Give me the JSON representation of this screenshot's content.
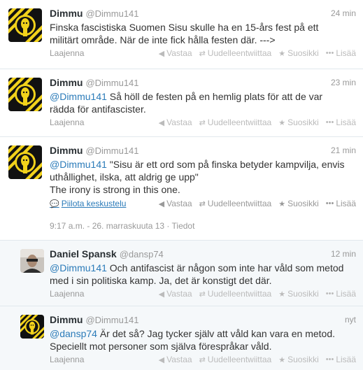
{
  "tweets": [
    {
      "name": "Dimmu",
      "handle": "@Dimmu141",
      "time": "24 min",
      "line1": "Finska fascistiska Suomen Sisu skulle ha en 15-års fest på ett",
      "line2": "militärt område. När de inte fick hålla festen där. --->",
      "expand": "Laajenna"
    },
    {
      "name": "Dimmu",
      "handle": "@Dimmu141",
      "time": "23 min",
      "mention": "@Dimmu141",
      "line1_rest": "  Så höll de festen på en hemlig plats för att de var",
      "line2": "rädda för antifascister.",
      "expand": "Laajenna"
    },
    {
      "name": "Dimmu",
      "handle": "@Dimmu141",
      "time": "21 min",
      "mention": "@Dimmu141",
      "line1_rest": " \"Sisu är ett ord som på finska betyder kampvilja, envis",
      "line2": "uthållighet, ilska, att aldrig ge upp\"",
      "line3": "The irony is strong in this one.",
      "hide_thread": "Piilota keskustelu",
      "meta": "9:17 a.m. - 26. marraskuuta 13 · Tiedot"
    },
    {
      "name": "Daniel Spansk",
      "handle": "@dansp74",
      "time": "12 min",
      "mention": "@Dimmu141",
      "line1_rest": " Och antifascist är någon som inte har våld som metod",
      "line2": "med i sin politiska kamp.  Ja, det är konstigt det där.",
      "expand": "Laajenna"
    },
    {
      "name": "Dimmu",
      "handle": "@Dimmu141",
      "time": "nyt",
      "mention": "@dansp74",
      "line1_rest": " Är det så? Jag tycker själv att våld kan vara en metod.",
      "line2": "Speciellt mot personer som själva förespråkar våld.",
      "expand": "Laajenna"
    }
  ],
  "actions": {
    "reply": "Vastaa",
    "retweet": "Uudelleentwiittaa",
    "favorite": "Suosikki",
    "more": "Lisää"
  },
  "icons": {
    "reply": "reply-arrow-icon",
    "retweet": "retweet-icon",
    "favorite": "star-icon",
    "more": "ellipsis-icon",
    "thread": "speech-bubble-icon"
  },
  "colors": {
    "link": "#2b7bb9",
    "muted": "#999999",
    "avatar_yellow": "#f2d21b",
    "avatar_black": "#111111"
  }
}
